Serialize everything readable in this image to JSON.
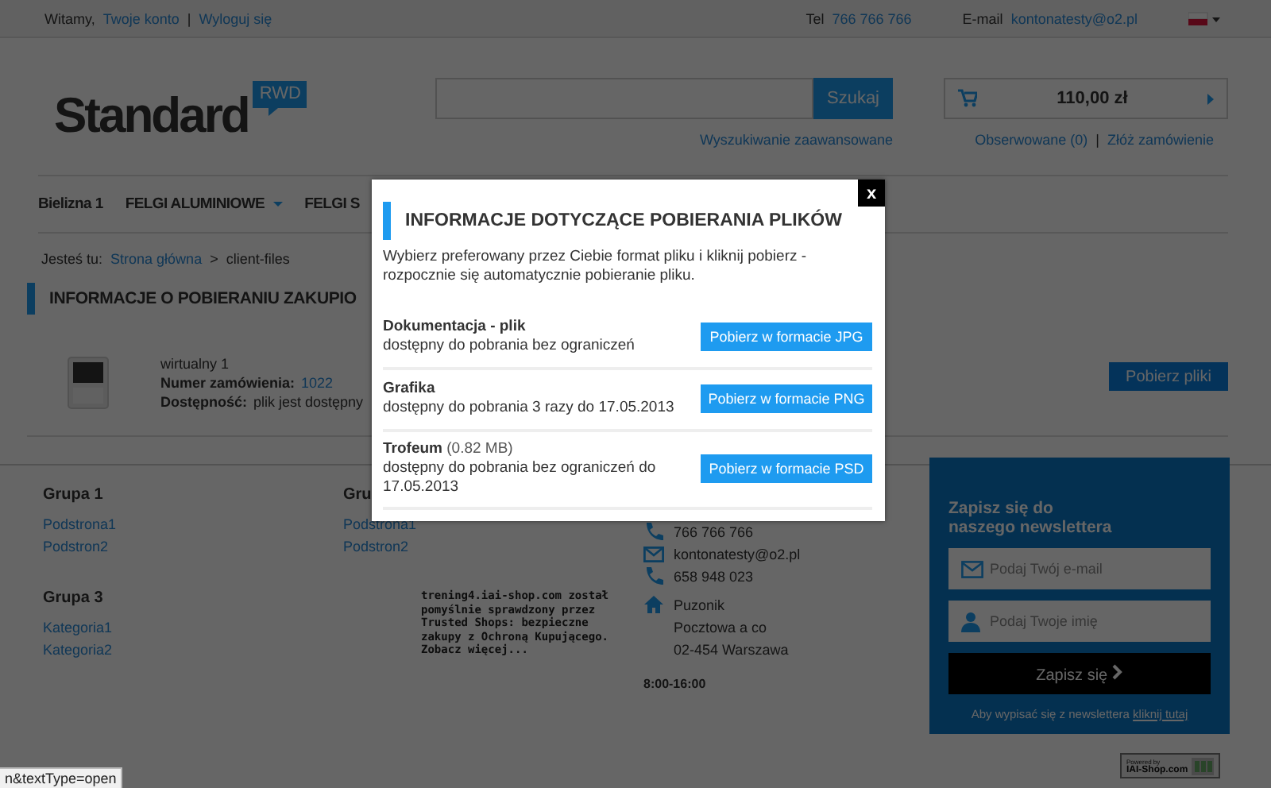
{
  "top_bar": {
    "greeting": "Witamy,",
    "links": [
      "Twoje konto",
      "Wyloguj się"
    ],
    "separator": "|",
    "phone_label": "Tel",
    "phone": "766 766 766",
    "email_label": "E-mail",
    "email": "kontonatesty@o2.pl"
  },
  "header": {
    "logo": {
      "text": "Standard",
      "badge": "RWD"
    },
    "search": {
      "button": "Szukaj",
      "advanced_link": "Wyszukiwanie zaawansowane"
    },
    "cart": {
      "total": "110,00 zł"
    },
    "links": [
      "Obserwowane (0)",
      "Złóż zamówienie"
    ],
    "separator": "|"
  },
  "nav": {
    "items": [
      {
        "label": "Bielizna 1",
        "dropdown": false
      },
      {
        "label": "FELGI ALUMINIOWE",
        "dropdown": true
      },
      {
        "label": "FELGI S",
        "dropdown": false
      }
    ]
  },
  "breadcrumb": {
    "label": "Jesteś tu:",
    "items": [
      "Strona główna",
      "client-files"
    ],
    "separator": ">"
  },
  "page_title": "INFORMACJE O POBIERANIU ZAKUPIO",
  "product": {
    "name": "wirtualny 1",
    "order_label": "Numer zamówienia:",
    "order_number": "1022",
    "availability_label": "Dostępność:",
    "availability": "plik jest dostępny",
    "button": "Pobierz pliki"
  },
  "footer": {
    "groups": [
      {
        "title": "Grupa 1",
        "links": [
          "Podstrona1",
          "Podstron2"
        ]
      },
      {
        "title": "Gru",
        "links": [
          "Podstrona1",
          "Podstron2"
        ]
      },
      {
        "title": "Grupa 3",
        "links": [
          "Kategoria1",
          "Kategoria2"
        ]
      }
    ],
    "contact": [
      {
        "kind": "phone",
        "lines": [
          "766 766 766"
        ]
      },
      {
        "kind": "email",
        "lines": [
          "kontonatesty@o2.pl"
        ]
      },
      {
        "kind": "phone",
        "lines": [
          "658 948 023"
        ]
      },
      {
        "kind": "address",
        "lines": [
          "Puzonik",
          "Pocztowa a co",
          "02-454 Warszawa"
        ]
      }
    ],
    "hours": "8:00-16:00",
    "trust_text": "trening4.iai-shop.com został pomyślnie sprawdzony przez Trusted Shops: bezpieczne zakupy z Ochroną Kupującego. Zobacz więcej...",
    "newsletter": {
      "title": "Zapisz się do naszego newslettera",
      "email_placeholder": "Podaj Twój e-mail",
      "name_placeholder": "Podaj Twoje imię",
      "button": "Zapisz się",
      "note": "Aby wypisać się z newslettera",
      "note_link": "kliknij tutaj"
    },
    "powered_by": {
      "line1": "Powered by",
      "line2": "IAI-Shop.com"
    }
  },
  "modal": {
    "close": "x",
    "title": "INFORMACJE DOTYCZĄCE POBIERANIA PLIKÓW",
    "description": "Wybierz preferowany przez Ciebie format pliku i kliknij pobierz - rozpocznie się automatycznie pobieranie pliku.",
    "files": [
      {
        "name": "Dokumentacja - plik",
        "info": "dostępny do pobrania bez ograniczeń",
        "button": "Pobierz w formacie JPG"
      },
      {
        "name": "Grafika",
        "info": "dostępny do pobrania 3 razy do 17.05.2013",
        "button": "Pobierz w formacie PNG"
      },
      {
        "name": "Trofeum",
        "size": "(0.82 MB)",
        "info": "dostępny do pobrania bez ograniczeń do 17.05.2013",
        "button": "Pobierz w formacie PSD"
      }
    ]
  },
  "status_bar": "n&textType=open"
}
